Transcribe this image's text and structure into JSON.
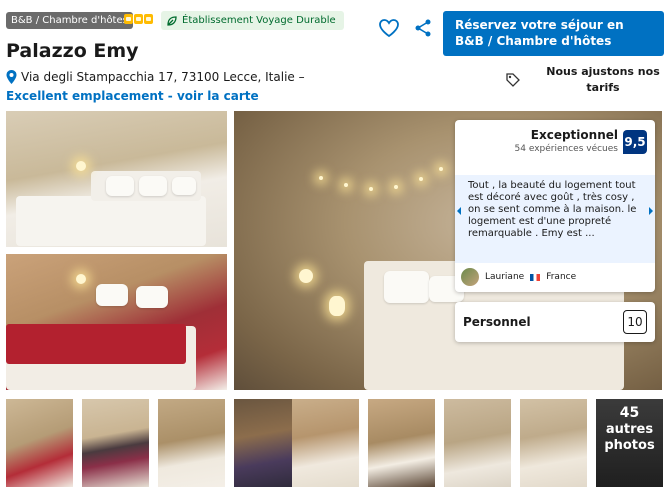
{
  "header": {
    "property_type": "B&B / Chambre d'hôtes",
    "stars": 3,
    "eco_label": "Établissement Voyage Durable",
    "title": "Palazzo Emy",
    "address": "Via degli Stampacchia 17, 73100 Lecce, Italie –",
    "map_link": "Excellent emplacement - voir la carte"
  },
  "actions": {
    "reserve_label": "Réservez votre séjour en B&B / Chambre d'hôtes",
    "price_match": "Nous ajustons nos tarifs"
  },
  "review": {
    "label": "Exceptionnel",
    "count": "54 expériences vécues",
    "score": "9,5",
    "quote": "Tout , la beauté du logement tout est décoré avec goût , très cosy , on se sent comme à la maison. le logement est d'une propreté remarquable . Emy est ...",
    "reviewer": "Lauriane",
    "country": "France"
  },
  "staff": {
    "label": "Personnel",
    "score": "10"
  },
  "gallery": {
    "more_count": "45",
    "more_label_1": "autres",
    "more_label_2": "photos"
  },
  "colors": {
    "primary": "#0071c2",
    "score_bg": "#003580",
    "eco_bg": "#e6f4e6",
    "eco_text": "#006b2e",
    "stars": "#febb02"
  }
}
